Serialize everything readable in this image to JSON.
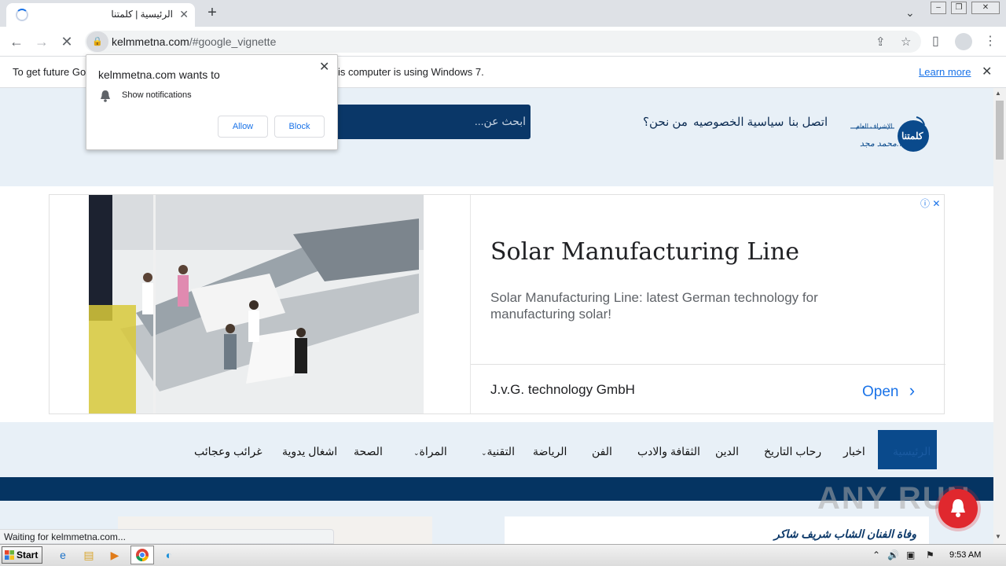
{
  "browser": {
    "tab_title": "الرئيسية | كلمتنا",
    "tab_close": "✕",
    "new_tab": "+",
    "url_host": "kelmmetna.com",
    "url_path": "/#google_vignette",
    "window_controls": [
      "minimize-icon",
      "restore-icon",
      "close-icon"
    ],
    "toolbar_icons": [
      "back-arrow-icon",
      "forward-arrow-icon",
      "stop-loading-icon",
      "share-icon",
      "star-icon",
      "side-panel-icon",
      "profile-icon",
      "menu-dots-icon"
    ]
  },
  "infobar": {
    "message_start": "To get future Go",
    "message_end": "is computer is using Windows 7.",
    "learn_more": "Learn more",
    "close": "✕"
  },
  "notification_prompt": {
    "title": "kelmmetna.com wants to",
    "permission": "Show notifications",
    "allow": "Allow",
    "block": "Block",
    "close": "✕"
  },
  "site": {
    "logo_name": "كلمتنا",
    "logo_tagline": "الإشراف العام",
    "logo_signature": "أ.محمد مجد",
    "top_nav": [
      "اتصل بنا",
      "سياسية الخصوصيه",
      "من نحن؟"
    ],
    "search_placeholder": "ابحث عن...",
    "main_nav": [
      "الرئيسية",
      "اخبار",
      "رحاب التاريخ",
      "الدين",
      "الثقافة والادب",
      "الفن",
      "الرياضة",
      "التقنية",
      "المراة",
      "الصحة",
      "اشغال يدوية",
      "غرائب وعجائب"
    ],
    "dropdown_items": [
      "التقنية",
      "المراة"
    ],
    "headline": "وفاة الفنان الشاب شريف شاكر"
  },
  "ad": {
    "title": "Solar Manufacturing Line",
    "description": "Solar Manufacturing Line: latest German technology for manufacturing solar!",
    "company": "J.v.G. technology GmbH",
    "cta": "Open",
    "cta_chevron": "›",
    "info_icon": "ⓘ",
    "close_icon": "✕"
  },
  "status_bar": {
    "text": "Waiting for kelmmetna.com..."
  },
  "watermark": "ANY RUN",
  "taskbar": {
    "start_label": "Start",
    "apps": [
      "ie-icon",
      "explorer-icon",
      "media-player-icon",
      "chrome-icon",
      "edge-icon"
    ],
    "clock": "9:53 AM"
  },
  "colors": {
    "site_navy": "#0a3768",
    "site_light": "#e8f0f7",
    "link_blue": "#1a73e8",
    "bell_red": "#e0282e"
  }
}
